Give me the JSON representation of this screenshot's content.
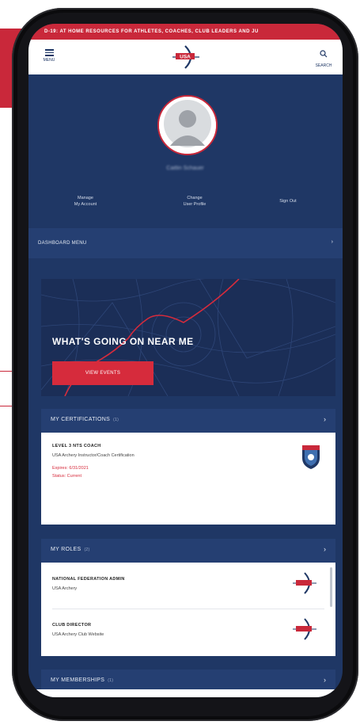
{
  "colors": {
    "brand_red": "#c9283a",
    "navy": "#1f3765",
    "navy_light": "#253f72",
    "white": "#ffffff"
  },
  "ticker": {
    "text": "D-19: AT HOME RESOURCES FOR ATHLETES, COACHES, CLUB LEADERS AND JU"
  },
  "header": {
    "menu_icon": "hamburger-icon",
    "menu_label": "MENU",
    "logo_text": "USA",
    "search_icon": "search-icon",
    "search_label": "SEARCH"
  },
  "profile": {
    "avatar_icon": "user-avatar-icon",
    "name": "Caitlin Schauer",
    "actions": [
      {
        "line1": "Manage",
        "line2": "My Account"
      },
      {
        "line1": "Change",
        "line2": "User Profile"
      },
      {
        "line1": "Sign Out",
        "line2": ""
      }
    ]
  },
  "dashboard": {
    "label": "DASHBOARD MENU",
    "icon": "chevron-right-icon"
  },
  "near_me": {
    "title": "WHAT'S GOING ON NEAR ME",
    "button": "VIEW EVENTS"
  },
  "certifications": {
    "label": "MY CERTIFICATIONS",
    "count": "(1)",
    "items": [
      {
        "title": "LEVEL 3 NTS COACH",
        "subtitle": "USA Archery Instructor/Coach Certification",
        "expires": "Expires: 6/31/2021",
        "status": "Status: Current",
        "badge_icon": "coach-badge-icon"
      }
    ]
  },
  "roles": {
    "label": "MY ROLES",
    "count": "(2)",
    "items": [
      {
        "title": "NATIONAL FEDERATION ADMIN",
        "org": "USA Archery",
        "logo_icon": "usa-archery-logo-icon"
      },
      {
        "title": "CLUB DIRECTOR",
        "org": "USA Archery Club Website",
        "logo_icon": "usa-archery-logo-icon"
      }
    ]
  },
  "memberships": {
    "label": "MY MEMBERSHIPS",
    "count": "(1)"
  }
}
